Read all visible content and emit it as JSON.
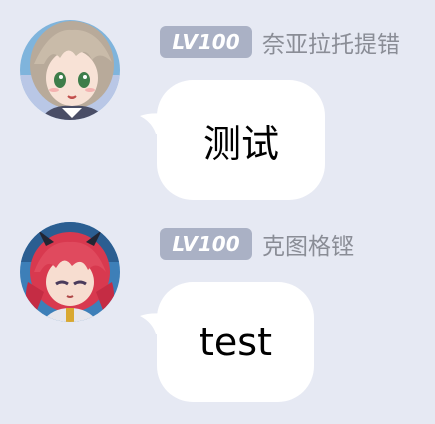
{
  "colors": {
    "background": "#e6e9f3",
    "bubble": "#ffffff",
    "badge": "#aab1c5",
    "username": "#8a8d96"
  },
  "messages": [
    {
      "badge": "LV100",
      "username": "奈亚拉托提错",
      "text": "测试",
      "avatar_icon": "anime-girl-avatar"
    },
    {
      "badge": "LV100",
      "username": "克图格铿",
      "text": "test",
      "avatar_icon": "anime-redhead-avatar"
    }
  ]
}
